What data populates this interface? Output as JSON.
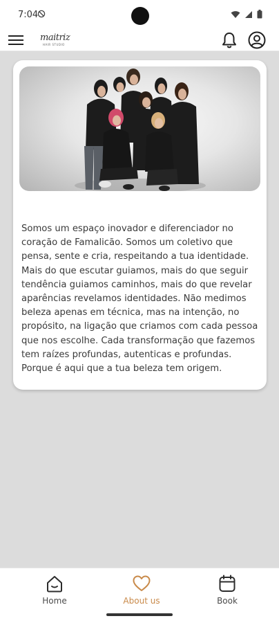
{
  "status_bar": {
    "time": "7:04"
  },
  "header": {
    "logo_text": "maitriz",
    "logo_subtitle": "HAIR STUDIO"
  },
  "about": {
    "text": "Somos um espaço inovador e diferenciador no coração de Famalicão. Somos um coletivo que pensa, sente e cria, respeitando a tua identidade. Mais do que escutar guiamos, mais do que seguir tendência guiamos caminhos, mais do que revelar aparências revelamos identidades. Não medimos beleza apenas em técnica, mas na intenção, no propósito, na ligação que criamos com cada pessoa que nos escolhe. Cada transformação que fazemos tem raízes profundas, autenticas e profundas. Porque é aqui que a tua beleza tem origem."
  },
  "bottom_nav": {
    "items": [
      {
        "label": "Home",
        "icon": "home-icon"
      },
      {
        "label": "About us",
        "icon": "heart-icon",
        "active": true
      },
      {
        "label": "Book",
        "icon": "calendar-icon"
      }
    ]
  },
  "colors": {
    "accent": "#c98a4a",
    "inactive": "#4a4a4a",
    "background": "#dcdcdc",
    "card": "#ffffff"
  }
}
